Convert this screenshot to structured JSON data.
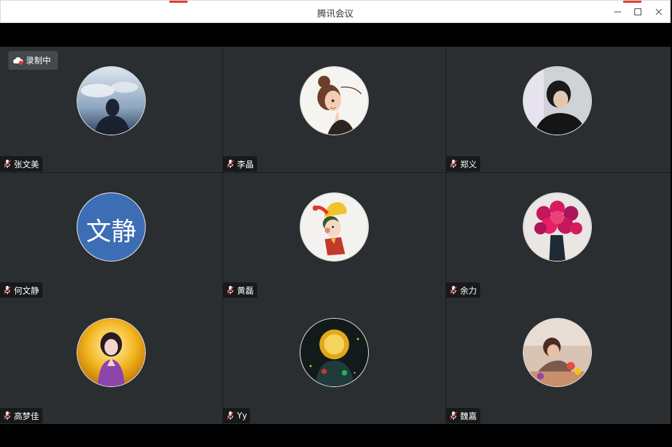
{
  "window": {
    "title": "腾讯会议",
    "accent_color": "#e53935"
  },
  "recording": {
    "label": "录制中"
  },
  "participants": [
    {
      "name": "张文美",
      "avatar": "photo-person-sky"
    },
    {
      "name": "李晶",
      "avatar": "illustration-girl"
    },
    {
      "name": "郑义",
      "avatar": "photo-man"
    },
    {
      "name": "何文静",
      "avatar": "text",
      "avatar_text": "文静",
      "avatar_color": "#3d6db5"
    },
    {
      "name": "黄磊",
      "avatar": "illustration-jester"
    },
    {
      "name": "余力",
      "avatar": "photo-roses"
    },
    {
      "name": "高梦佳",
      "avatar": "photo-woman-praying"
    },
    {
      "name": "Yy",
      "avatar": "illustration-astronaut"
    },
    {
      "name": "魏嘉",
      "avatar": "photo-person-food"
    }
  ]
}
